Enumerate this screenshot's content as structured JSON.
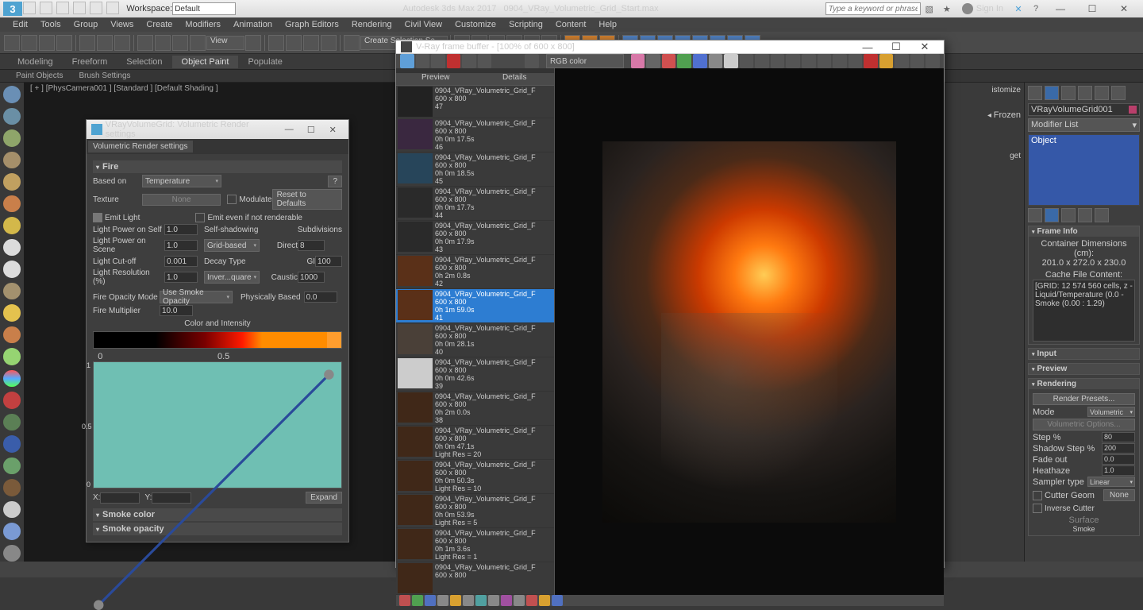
{
  "app": {
    "title_prefix": "Autodesk 3ds Max 2017",
    "document": "0904_VRay_Volumetric_Grid_Start.max",
    "workspace_label": "Workspace:",
    "workspace_value": "Default",
    "search_placeholder": "Type a keyword or phrase",
    "signin": "Sign In"
  },
  "menu": [
    "Edit",
    "Tools",
    "Group",
    "Views",
    "Create",
    "Modifiers",
    "Animation",
    "Graph Editors",
    "Rendering",
    "Civil View",
    "Customize",
    "Scripting",
    "Content",
    "Help"
  ],
  "toolbar": {
    "view_label": "View",
    "create_sel": "Create Selection Se"
  },
  "ribbon_tabs": [
    "Modeling",
    "Freeform",
    "Selection",
    "Object Paint",
    "Populate"
  ],
  "ribbon_active": "Object Paint",
  "subribbon": [
    "Paint Objects",
    "Brush Settings"
  ],
  "viewport_label": "[ + ] [PhysCamera001 ] [Standard ] [Default Shading ]",
  "scene_explorer": {
    "frozen": "Frozen",
    "target": "get",
    "customize": "istomize"
  },
  "render_dialog": {
    "title": "VRayVolumeGrid: Volumetric Render settings",
    "tab": "Volumetric Render settings",
    "fire_section": "Fire",
    "based_on": "Based on",
    "based_on_value": "Temperature",
    "help": "?",
    "texture": "Texture",
    "texture_value": "None",
    "modulate": "Modulate",
    "reset": "Reset to Defaults",
    "emit_light": "Emit Light",
    "emit_non_render": "Emit even if not renderable",
    "lp_self": "Light Power on Self",
    "lp_self_v": "1.0",
    "self_shadow": "Self-shadowing",
    "subdivisions": "Subdivisions",
    "lp_scene": "Light Power on Scene",
    "lp_scene_v": "1.0",
    "lp_scene_mode": "Grid-based",
    "direct": "Direct",
    "direct_v": "8",
    "cutoff": "Light Cut-off",
    "cutoff_v": "0.001",
    "decay": "Decay Type",
    "gi": "GI",
    "gi_v": "100",
    "lightres": "Light Resolution (%)",
    "lightres_v": "1.0",
    "decay_v": "Inver...quare",
    "caustic": "Caustic",
    "caustic_v": "1000",
    "opacity_mode": "Fire Opacity Mode",
    "opacity_mode_v": "Use Smoke Opacity",
    "phys_based": "Physically Based",
    "phys_based_v": "0.0",
    "fire_mult": "Fire Multiplier",
    "fire_mult_v": "10.0",
    "color_intensity": "Color and Intensity",
    "ruler0": "0",
    "ruler05": "0.5",
    "axis1": "1",
    "axis05": "0.5",
    "axis0": "0",
    "x_label": "X:",
    "y_label": "Y:",
    "expand": "Expand",
    "smoke_color": "Smoke color",
    "smoke_opacity": "Smoke opacity"
  },
  "vfb": {
    "title": "V-Ray frame buffer - [100% of 600 x 800]",
    "channel": "RGB color",
    "head_preview": "Preview",
    "head_details": "Details",
    "history": [
      {
        "n": "0904_VRay_Volumetric_Grid_F",
        "res": "600 x 800",
        "time": "",
        "idx": "47"
      },
      {
        "n": "0904_VRay_Volumetric_Grid_F",
        "res": "600 x 800",
        "time": "0h 0m 17.5s",
        "idx": "46"
      },
      {
        "n": "0904_VRay_Volumetric_Grid_F",
        "res": "600 x 800",
        "time": "0h 0m 18.5s",
        "idx": "45"
      },
      {
        "n": "0904_VRay_Volumetric_Grid_F",
        "res": "600 x 800",
        "time": "0h 0m 17.7s",
        "idx": "44"
      },
      {
        "n": "0904_VRay_Volumetric_Grid_F",
        "res": "600 x 800",
        "time": "0h 0m 17.9s",
        "idx": "43"
      },
      {
        "n": "0904_VRay_Volumetric_Grid_F",
        "res": "600 x 800",
        "time": "0h 2m 0.8s",
        "idx": "42"
      },
      {
        "n": "0904_VRay_Volumetric_Grid_F",
        "res": "600 x 800",
        "time": "0h 1m 59.0s",
        "idx": "41",
        "sel": true
      },
      {
        "n": "0904_VRay_Volumetric_Grid_F",
        "res": "600 x 800",
        "time": "0h 0m 28.1s",
        "idx": "40"
      },
      {
        "n": "0904_VRay_Volumetric_Grid_F",
        "res": "600 x 800",
        "time": "0h 0m 42.6s",
        "idx": "39"
      },
      {
        "n": "0904_VRay_Volumetric_Grid_F",
        "res": "600 x 800",
        "time": "0h 2m 0.0s",
        "idx": "38"
      },
      {
        "n": "0904_VRay_Volumetric_Grid_F",
        "res": "600 x 800",
        "time": "0h 0m 47.1s",
        "idx": "Light Res = 20"
      },
      {
        "n": "0904_VRay_Volumetric_Grid_F",
        "res": "600 x 800",
        "time": "0h 0m 50.3s",
        "idx": "Light Res = 10"
      },
      {
        "n": "0904_VRay_Volumetric_Grid_F",
        "res": "600 x 800",
        "time": "0h 0m 53.9s",
        "idx": "Light Res = 5"
      },
      {
        "n": "0904_VRay_Volumetric_Grid_F",
        "res": "600 x 800",
        "time": "0h 1m 3.6s",
        "idx": "Light Res = 1"
      },
      {
        "n": "0904_VRay_Volumetric_Grid_F",
        "res": "600 x 800",
        "time": "",
        "idx": ""
      }
    ]
  },
  "command_panel": {
    "object_name": "VRayVolumeGrid001",
    "modifier_list": "Modifier List",
    "stack_item": "Object",
    "frame_info": "Frame Info",
    "dims_label": "Container Dimensions (cm):",
    "dims": "201.0 x 272.0 x 230.0",
    "cache_label": "Cache File Content:",
    "cache_text": "[GRID: 12 574 560 cells, z\n - Liquid/Temperature (0.0\n - Smoke (0.00 : 1.29)",
    "input": "Input",
    "preview": "Preview",
    "rendering": "Rendering",
    "render_presets": "Render Presets...",
    "mode": "Mode",
    "mode_v": "Volumetric",
    "vol_opts": "Volumetric Options...",
    "step": "Step %",
    "step_v": "80",
    "shadow": "Shadow Step %",
    "shadow_v": "200",
    "fade": "Fade out",
    "fade_v": "0.0",
    "heat": "Heathaze",
    "heat_v": "1.0",
    "sampler": "Sampler type",
    "sampler_v": "Linear",
    "cutter_geom": "Cutter Geom",
    "cutter_none": "None",
    "inverse_cutter": "Inverse Cutter",
    "surface": "Surface",
    "smoke": "Smoke"
  }
}
